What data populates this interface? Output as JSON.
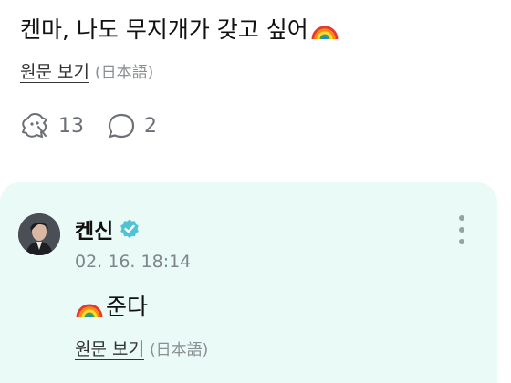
{
  "post": {
    "text": "켄마, 나도 무지개가 갖고 싶어",
    "emoji_icon": "rainbow-emoji",
    "translate_label": "원문 보기",
    "translate_lang": "(日本語)"
  },
  "actions": {
    "like_icon": "sticker-reaction-icon",
    "like_count": "13",
    "comment_icon": "comment-bubble-icon",
    "comment_count": "2"
  },
  "reply": {
    "author": "켄신",
    "verified_icon": "verified-badge-icon",
    "verified_color": "#4fc3d6",
    "timestamp": "02. 16. 18:14",
    "text": "준다",
    "emoji_icon": "rainbow-emoji",
    "translate_label": "원문 보기",
    "translate_lang": "(日本語)",
    "more_icon": "more-vertical-icon",
    "card_color": "#eafaf6"
  }
}
